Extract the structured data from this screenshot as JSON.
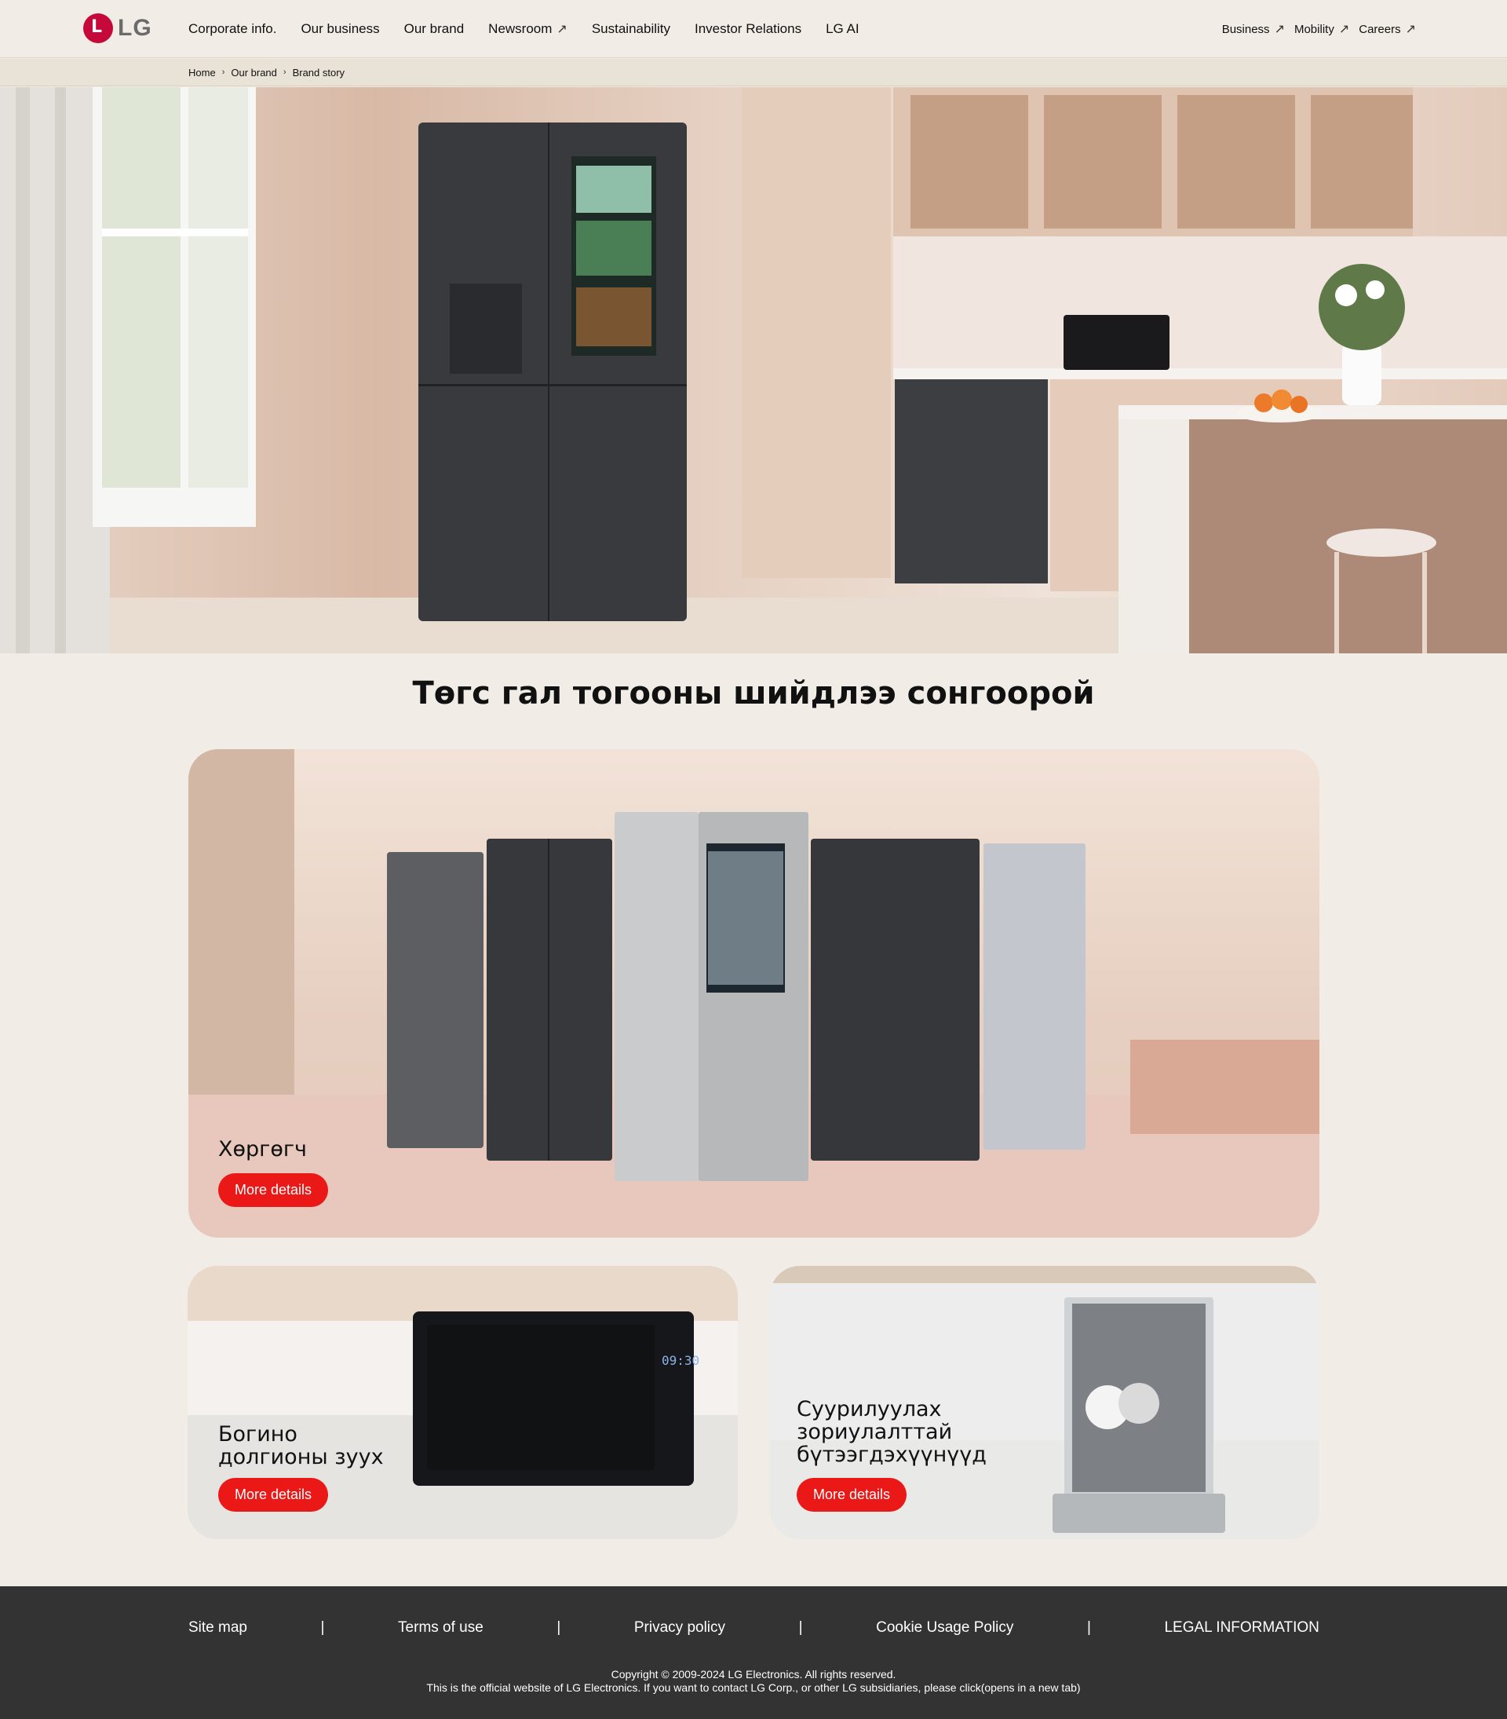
{
  "header": {
    "logo_text": "LG",
    "nav": [
      "Corporate info.",
      "Our business",
      "Our brand",
      "Newsroom",
      "Sustainability",
      "Investor Relations",
      "LG AI"
    ],
    "util": [
      "Business",
      "Mobility",
      "Careers"
    ]
  },
  "breadcrumb": [
    "Home",
    "Our brand",
    "Brand story"
  ],
  "section_title": "Төгс гал тогооны шийдлээ сонгоорой",
  "cards": {
    "fridge": {
      "label": "Хөргөгч",
      "button": "More details"
    },
    "microwave": {
      "label_line1": "Богино",
      "label_line2": "долгионы зуух",
      "button": "More details",
      "display_time": "09:30"
    },
    "dishwasher": {
      "label_line1": "Суурилуулах",
      "label_line2": "зориулалттай",
      "label_line3": "бүтээгдэхүүнүүд",
      "button": "More details"
    }
  },
  "footer": {
    "links": [
      "Site map",
      "Terms of use",
      "Privacy policy",
      "Cookie Usage Policy",
      "LEGAL INFORMATION"
    ],
    "separator": "|",
    "copyright": "Copyright © 2009-2024 LG Electronics. All rights reserved.",
    "notice": "This is the official website of LG Electronics. If you want to contact LG Corp., or other LG subsidiaries, please click(opens in a new tab)"
  },
  "colors": {
    "accent": "#ea1917",
    "brand": "#c6093b",
    "footer_bg": "#333333",
    "page_bg": "#f1ece5"
  }
}
